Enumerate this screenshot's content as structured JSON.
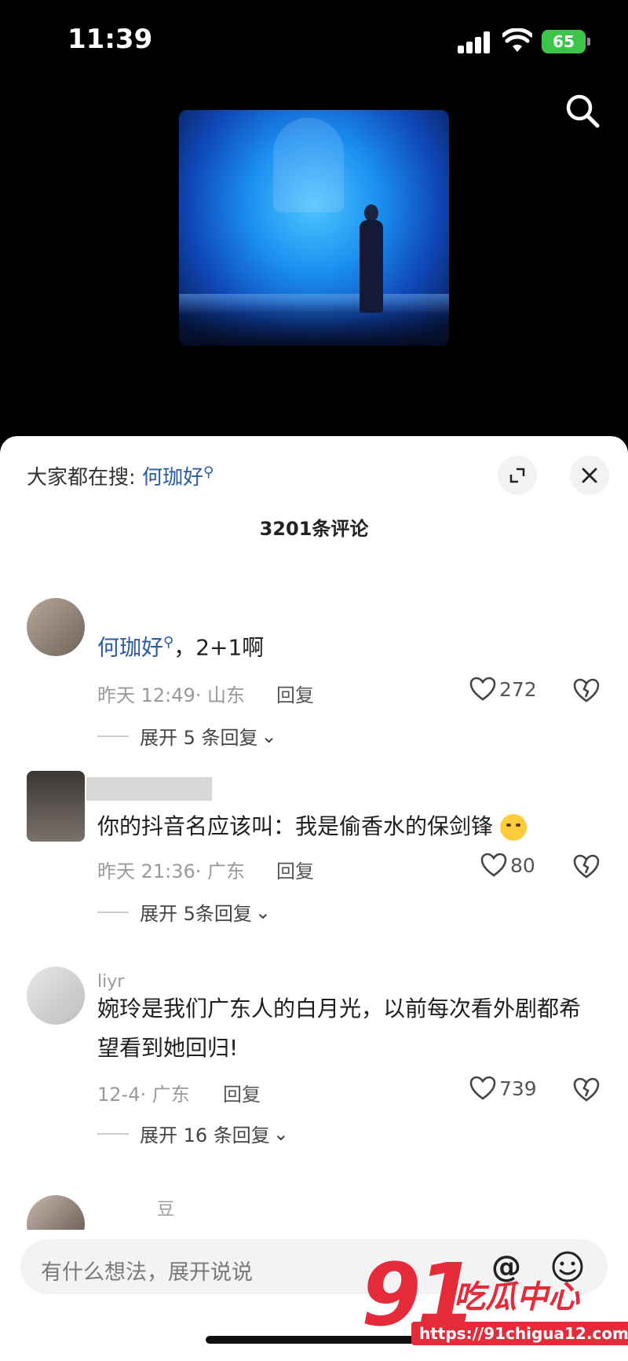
{
  "status_bar": {
    "time": "11:39",
    "battery": "65"
  },
  "video": {
    "search_icon": "search-icon"
  },
  "sheet": {
    "hot_search_prefix": "大家都在搜:",
    "hot_search_keyword": "何珈好",
    "comment_count": "3201条评论"
  },
  "comments": [
    {
      "mention": "何珈好",
      "text": "，2+1啊",
      "date": "昨天 12:49",
      "location": "· 山东",
      "reply": "回复",
      "likes": "272",
      "expand": "展开 5 条回复"
    },
    {
      "text": "你的抖音名应该叫：我是偷香水的保剑锋",
      "date": "昨天 21:36",
      "location": "· 广东",
      "reply": "回复",
      "likes": "80",
      "expand": "展开 5条回复"
    },
    {
      "username": "liyr",
      "text": "婉玲是我们广东人的白月光，以前每次看外剧都希望看到她回归!",
      "date": "12-4",
      "location": "· 广东",
      "reply": "回复",
      "likes": "739",
      "expand": "展开 16 条回复"
    },
    {
      "username": "豆"
    }
  ],
  "input": {
    "placeholder": "有什么想法，展开说说",
    "at_symbol": "@"
  },
  "watermark": {
    "number": "91",
    "text": "吃瓜中心",
    "url": "https://91chigua12.com"
  },
  "colors": {
    "accent": "#2b5aa8",
    "brand": "#e52a3a",
    "battery": "#3cc54a"
  }
}
